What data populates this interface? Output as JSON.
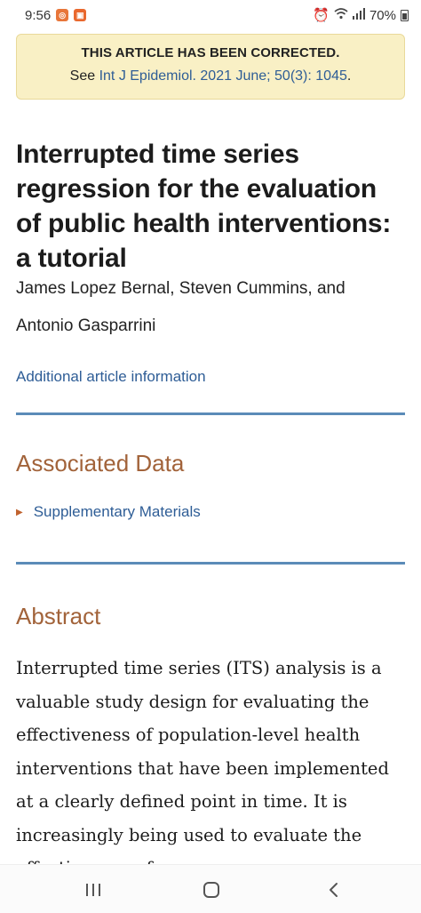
{
  "status_bar": {
    "time": "9:56",
    "battery": "70%",
    "icons": [
      "notification-app-icon",
      "notification-app-icon",
      "alarm-icon",
      "wifi-icon",
      "signal-icon",
      "battery-icon"
    ]
  },
  "banner": {
    "title": "THIS ARTICLE HAS BEEN CORRECTED.",
    "see_prefix": "See ",
    "link_text": "Int J Epidemiol. 2021 June; 50(3): 1045",
    "suffix": "."
  },
  "article": {
    "title": "Interrupted time series regression for the evaluation of public health interventions: a tutorial",
    "authors_line1": "James Lopez Bernal, Steven Cummins, and",
    "authors_line2": "Antonio Gasparrini",
    "additional_info": "Additional article information"
  },
  "associated_data": {
    "heading": "Associated Data",
    "items": [
      {
        "label": "Supplementary Materials"
      }
    ]
  },
  "abstract": {
    "heading": "Abstract",
    "text": "Interrupted time series (ITS) analysis is a valuable study design for evaluating the effectiveness of population-level health interventions that have been implemented at a clearly defined point in time. It is increasingly being used to evaluate the effectiveness of"
  },
  "nav": {
    "icons": [
      "recents-icon",
      "home-icon",
      "back-icon"
    ]
  },
  "colors": {
    "banner_bg": "#f9f0c5",
    "link": "#2e5d96",
    "section_heading": "#a2633a",
    "rule": "#5b8bb8"
  }
}
